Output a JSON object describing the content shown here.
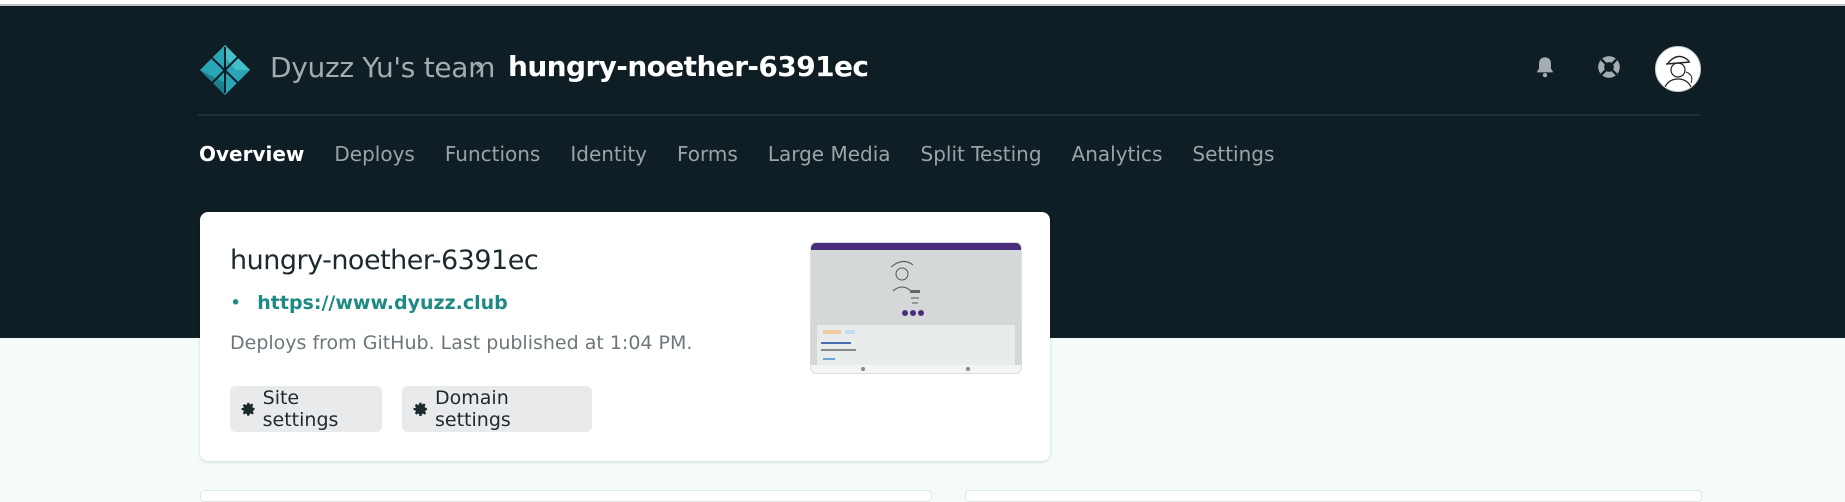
{
  "header": {
    "team": "Dyuzz Yu's team",
    "separator": "›",
    "site": "hungry-noether-6391ec",
    "icons": [
      "netlify-logo-icon",
      "bell-icon",
      "lifebuoy-icon",
      "avatar"
    ]
  },
  "nav": {
    "items": [
      {
        "label": "Overview",
        "active": true
      },
      {
        "label": "Deploys"
      },
      {
        "label": "Functions"
      },
      {
        "label": "Identity"
      },
      {
        "label": "Forms"
      },
      {
        "label": "Large Media"
      },
      {
        "label": "Split Testing"
      },
      {
        "label": "Analytics"
      },
      {
        "label": "Settings"
      }
    ]
  },
  "card": {
    "title": "hungry-noether-6391ec",
    "bullet": "•",
    "url": "https://www.dyuzz.club",
    "description": "Deploys from GitHub. Last published at 1:04 PM.",
    "buttons": {
      "site_settings": "Site settings",
      "domain_settings": "Domain settings"
    }
  },
  "colors": {
    "header_bg": "#0f1d24",
    "accent": "#1f8a83",
    "page_bg": "#f5fafa"
  }
}
